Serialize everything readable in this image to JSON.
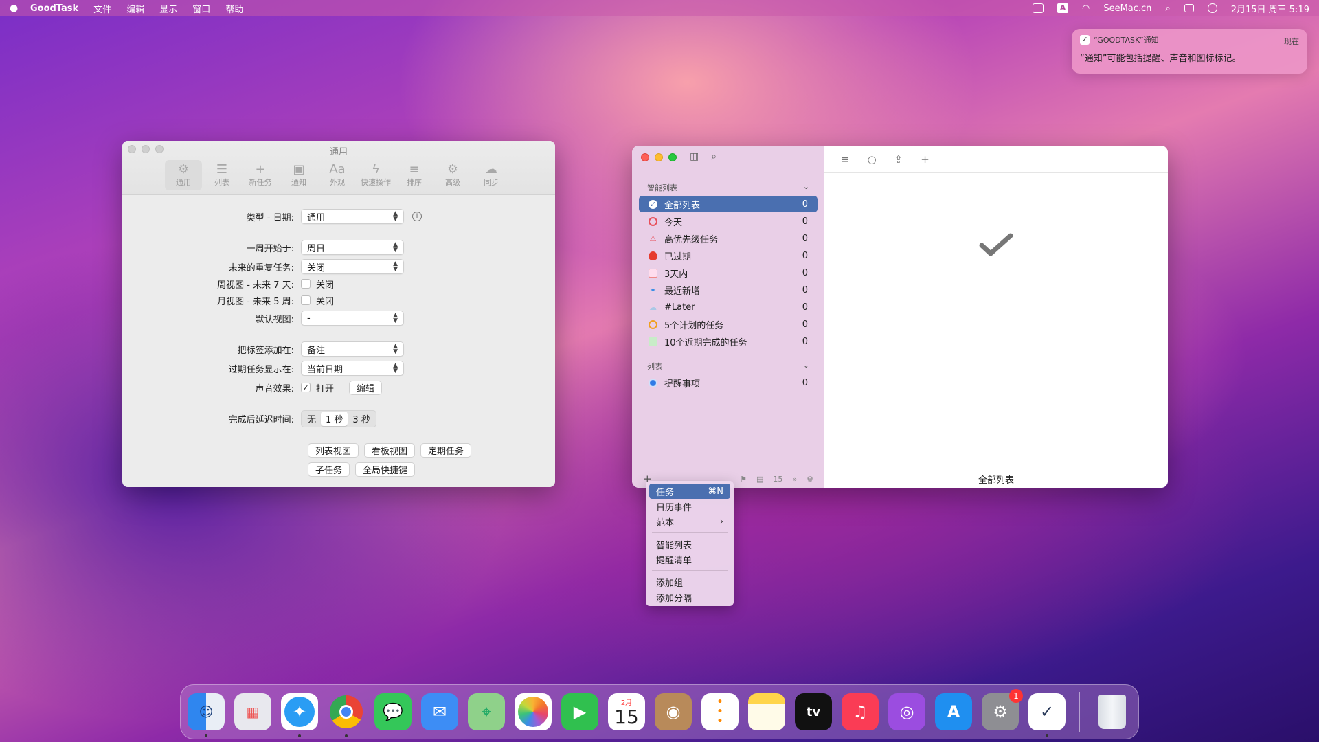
{
  "menubar": {
    "app": "GoodTask",
    "items": [
      "文件",
      "编辑",
      "显示",
      "窗口",
      "帮助"
    ],
    "site": "SeeMac.cn",
    "input_icon_label": "A",
    "datetime": "2月15日 周三 5:19"
  },
  "notification": {
    "app": "“GOODTASK”通知",
    "time": "现在",
    "body": "“通知”可能包括提醒、声音和图标标记。"
  },
  "prefs": {
    "title": "通用",
    "tabs": [
      "通用",
      "列表",
      "新任务",
      "通知",
      "外观",
      "快速操作",
      "排序",
      "高级",
      "同步"
    ],
    "rows": {
      "type_date": {
        "label": "类型 - 日期:",
        "value": "通用"
      },
      "week_start": {
        "label": "一周开始于:",
        "value": "周日"
      },
      "future_repeat": {
        "label": "未来的重复任务:",
        "value": "关闭"
      },
      "week_view": {
        "label": "周视图 - 未来 7 天:",
        "value": "关闭"
      },
      "month_view": {
        "label": "月视图 - 未来 5 周:",
        "value": "关闭"
      },
      "default_view": {
        "label": "默认视图:",
        "value": "-"
      },
      "tag_add": {
        "label": "把标签添加在:",
        "value": "备注"
      },
      "overdue": {
        "label": "过期任务显示在:",
        "value": "当前日期"
      },
      "sound": {
        "label": "声音效果:",
        "value": "打开",
        "edit": "编辑",
        "checkmark": "✓"
      },
      "delay": {
        "label": "完成后延迟时间:",
        "options": [
          "无",
          "1 秒",
          "3 秒"
        ],
        "selected": "1 秒"
      }
    },
    "buttons": [
      "列表视图",
      "看板视图",
      "定期任务",
      "子任务",
      "全局快捷键"
    ]
  },
  "main": {
    "smart_section": "智能列表",
    "smart_lists": [
      {
        "label": "全部列表",
        "count": "0",
        "icon": "checkmark-circle-icon",
        "color": "#ffffff"
      },
      {
        "label": "今天",
        "count": "0",
        "icon": "target-icon",
        "color": "#e8505b"
      },
      {
        "label": "高优先级任务",
        "count": "0",
        "icon": "warning-icon",
        "color": "#e8505b"
      },
      {
        "label": "已过期",
        "count": "0",
        "icon": "flame-icon",
        "color": "#e63b2e"
      },
      {
        "label": "3天内",
        "count": "0",
        "icon": "calendar-icon",
        "color": "#f08a8a"
      },
      {
        "label": "最近新增",
        "count": "0",
        "icon": "sparkle-icon",
        "color": "#3a8ee6"
      },
      {
        "label": "#Later",
        "count": "0",
        "icon": "cloud-icon",
        "color": "#aac8e6"
      },
      {
        "label": "5个计划的任务",
        "count": "0",
        "icon": "clock-icon",
        "color": "#f0a020"
      },
      {
        "label": "10个近期完成的任务",
        "count": "0",
        "icon": "done-icon",
        "color": "#5bbf6a"
      }
    ],
    "list_section": "列表",
    "lists": [
      {
        "label": "提醒事项",
        "count": "0",
        "color": "#2f7be6"
      }
    ],
    "footer_title": "全部列表",
    "footer_calendar_day": "15"
  },
  "context_menu": {
    "items": [
      {
        "label": "任务",
        "shortcut": "⌘N"
      },
      {
        "label": "日历事件"
      },
      {
        "label": "范本",
        "submenu": "›"
      },
      {
        "label": "智能列表"
      },
      {
        "label": "提醒清单"
      },
      {
        "label": "添加组"
      },
      {
        "label": "添加分隔"
      }
    ]
  },
  "dock": {
    "calendar_month": "2月",
    "calendar_day": "15",
    "tv_label": "tv",
    "settings_badge": "1",
    "apps": [
      {
        "name": "finder-icon",
        "color": "#3a8ef0"
      },
      {
        "name": "launchpad-icon",
        "color": "#e8e8ee"
      },
      {
        "name": "safari-icon",
        "color": "#2a9df4"
      },
      {
        "name": "chrome-icon",
        "color": "#ffffff"
      },
      {
        "name": "messages-icon",
        "color": "#34c759"
      },
      {
        "name": "mail-icon",
        "color": "#3d8df5"
      },
      {
        "name": "maps-icon",
        "color": "#8fd18a"
      },
      {
        "name": "photos-icon",
        "color": "#ffffff"
      },
      {
        "name": "facetime-icon",
        "color": "#30c04f"
      },
      {
        "name": "calendar-icon",
        "color": "#ffffff"
      },
      {
        "name": "contacts-icon",
        "color": "#b88a5a"
      },
      {
        "name": "reminders-icon",
        "color": "#ffffff"
      },
      {
        "name": "notes-icon",
        "color": "#ffd54a"
      },
      {
        "name": "apple-tv-icon",
        "color": "#111111"
      },
      {
        "name": "music-icon",
        "color": "#fa3c55"
      },
      {
        "name": "podcasts-icon",
        "color": "#9b4de0"
      },
      {
        "name": "app-store-icon",
        "color": "#1f8ff0"
      },
      {
        "name": "system-settings-icon",
        "color": "#8e8e93"
      },
      {
        "name": "goodtask-icon",
        "color": "#ffffff"
      },
      {
        "name": "trash-icon",
        "color": "#e8e8ee"
      }
    ]
  }
}
